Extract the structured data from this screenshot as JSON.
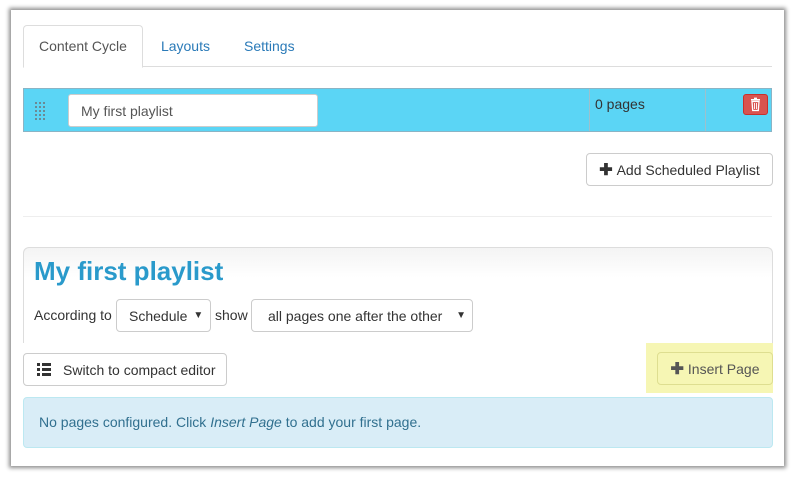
{
  "tabs": [
    {
      "label": "Content Cycle",
      "active": true
    },
    {
      "label": "Layouts",
      "active": false
    },
    {
      "label": "Settings",
      "active": false
    }
  ],
  "playlist_row": {
    "name_value": "My first playlist",
    "pages_count": "0 pages",
    "row_color": "#5bd5f5",
    "delete_icon": "trash-icon"
  },
  "add_scheduled_playlist_label": "Add Scheduled Playlist",
  "playlist_panel": {
    "title": "My first playlist",
    "according_label": "According to",
    "schedule_value": "Schedule",
    "show_label": "show",
    "pages_mode_value": "all pages one after the other"
  },
  "compact_editor_label": "Switch to compact editor",
  "insert_page_label": "Insert Page",
  "alert": {
    "prefix": "No pages configured. Click ",
    "link": "Insert Page",
    "suffix": " to add your first page."
  },
  "colors": {
    "accent": "#2a9acb",
    "delete": "#d9534f",
    "highlight": "#f6f6b4",
    "info_bg": "#d9edf7"
  }
}
